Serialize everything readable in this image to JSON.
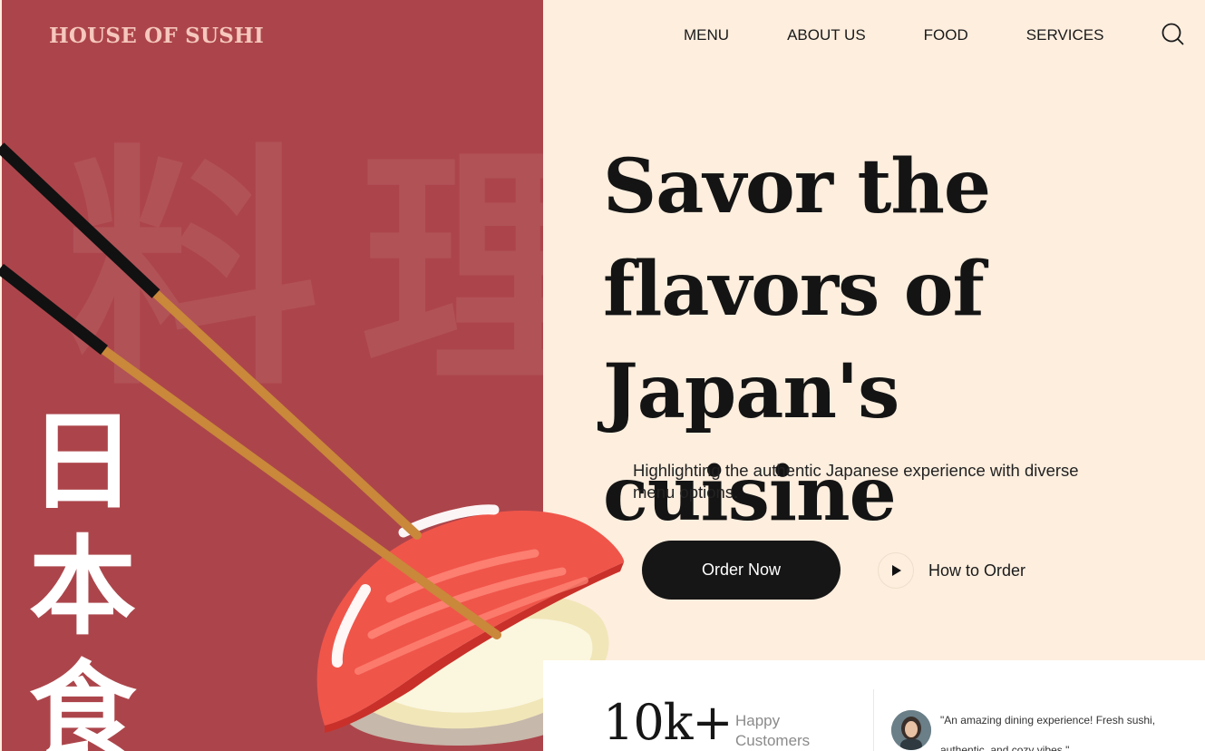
{
  "brand": {
    "name": "HOUSE OF SUSHI"
  },
  "nav": {
    "items": [
      {
        "label": "MENU"
      },
      {
        "label": "ABOUT US"
      },
      {
        "label": "FOOD"
      },
      {
        "label": "SERVICES"
      }
    ],
    "search_icon": "search-icon"
  },
  "hero": {
    "headline_lines": [
      "Savor the",
      "flavors of",
      "Japan's cuisine"
    ],
    "subtext": "Highlighting the authentic Japanese experience with diverse menu options.",
    "primary_button": "Order Now",
    "secondary_link": "How to Order",
    "secondary_icon": "play-icon",
    "vertical_kanji": [
      "日",
      "本",
      "食"
    ],
    "background_kanji": [
      "料",
      "理"
    ]
  },
  "stats": {
    "number": "10k+",
    "label": "Happy Customers"
  },
  "testimonial": {
    "quote": "\"An amazing dining experience! Fresh sushi, authentic, and cozy vibes.\""
  },
  "colors": {
    "panel_red": "#ac454b",
    "cream": "#fdeede",
    "button_dark": "#161616",
    "brand_pink": "#f6c7bd",
    "salmon": "#f0554a",
    "rice": "#f4eed0"
  }
}
